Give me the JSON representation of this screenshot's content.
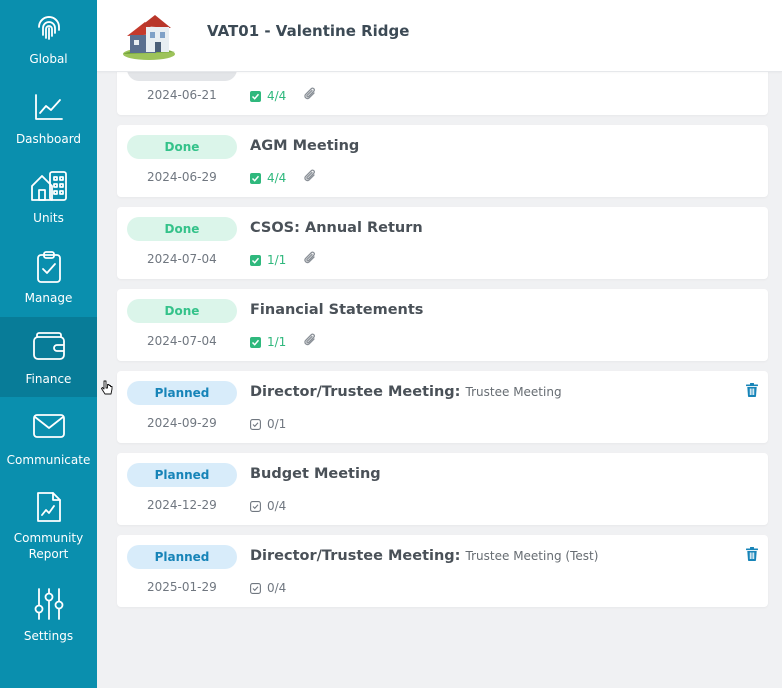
{
  "header": {
    "title": "VAT01 - Valentine Ridge"
  },
  "sidebar": {
    "items": [
      {
        "label": "Global",
        "icon": "fingerprint-icon"
      },
      {
        "label": "Dashboard",
        "icon": "chart-line-icon"
      },
      {
        "label": "Units",
        "icon": "units-building-icon"
      },
      {
        "label": "Manage",
        "icon": "clipboard-check-icon"
      },
      {
        "label": "Finance",
        "icon": "wallet-icon",
        "active": true
      },
      {
        "label": "Communicate",
        "icon": "envelope-icon"
      },
      {
        "label": "Community Report",
        "icon": "document-chart-icon"
      },
      {
        "label": "Settings",
        "icon": "sliders-icon"
      }
    ]
  },
  "colors": {
    "sidebar": "#0a8fae",
    "done": "#34c28a",
    "planned": "#1784b8"
  },
  "tasks": [
    {
      "status": "",
      "title": "",
      "date": "2024-06-21",
      "progress": "4/4",
      "attachment": true
    },
    {
      "status": "Done",
      "title": "AGM Meeting",
      "subtitle": "",
      "date": "2024-06-29",
      "progress": "4/4",
      "attachment": true
    },
    {
      "status": "Done",
      "title": "CSOS: Annual Return",
      "subtitle": "",
      "date": "2024-07-04",
      "progress": "1/1",
      "attachment": true
    },
    {
      "status": "Done",
      "title": "Financial Statements",
      "subtitle": "",
      "date": "2024-07-04",
      "progress": "1/1",
      "attachment": true
    },
    {
      "status": "Planned",
      "title": "Director/Trustee Meeting:",
      "subtitle": "Trustee Meeting",
      "date": "2024-09-29",
      "progress": "0/1",
      "deletable": true
    },
    {
      "status": "Planned",
      "title": "Budget Meeting",
      "subtitle": "",
      "date": "2024-12-29",
      "progress": "0/4"
    },
    {
      "status": "Planned",
      "title": "Director/Trustee Meeting:",
      "subtitle": "Trustee Meeting (Test)",
      "date": "2025-01-29",
      "progress": "0/4",
      "deletable": true
    }
  ]
}
